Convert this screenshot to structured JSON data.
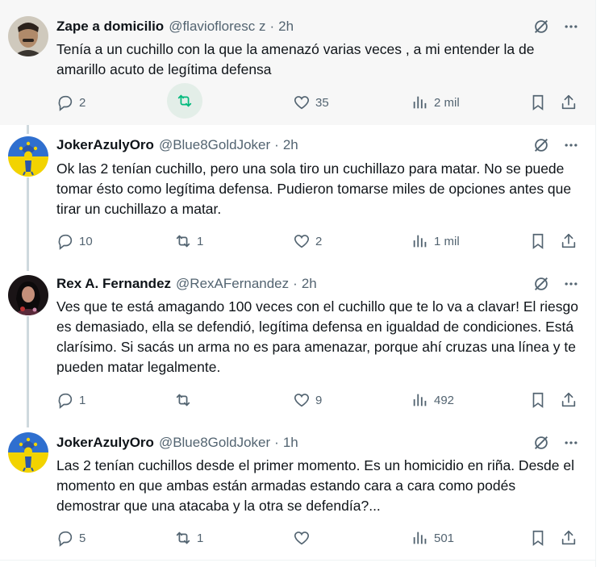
{
  "replies": [
    {
      "name": "Zape a domicilio",
      "handle": "@flaviofloresc z",
      "time": "2h",
      "text": "Tenía a un cuchillo  con la que la amenazó varias veces , a mi entender la de amarillo acuto de legítima defensa",
      "replies": "2",
      "retweets": "",
      "likes": "35",
      "views": "2 mil",
      "retweeted": true,
      "avatar": "portrait-man-mustache"
    },
    {
      "name": "JokerAzulyOro",
      "handle": "@Blue8GoldJoker",
      "time": "2h",
      "text": "Ok las 2 tenían cuchillo, pero una sola tiro un cuchillazo para matar. No se puede tomar ésto como legítima defensa. Pudieron tomarse miles de opciones antes que tirar un cuchillazo a matar.",
      "replies": "10",
      "retweets": "1",
      "likes": "2",
      "views": "1 mil",
      "retweeted": false,
      "avatar": "blue-yellow-jester"
    },
    {
      "name": "Rex A. Fernandez",
      "handle": "@RexAFernandez",
      "time": "2h",
      "text": "Ves que te está amagando 100 veces con el cuchillo que te lo va a clavar! El riesgo es demasiado, ella se defendió, legítima defensa en igualdad de condiciones. Está clarísimo. Si sacás un arma no es para amenazar, porque ahí cruzas una línea y te pueden matar legalmente.",
      "replies": "1",
      "retweets": "",
      "likes": "9",
      "views": "492",
      "retweeted": false,
      "avatar": "rock-musician"
    },
    {
      "name": "JokerAzulyOro",
      "handle": "@Blue8GoldJoker",
      "time": "1h",
      "text": "Las 2 tenían cuchillos desde el primer momento. Es un homicidio en riña. Desde el momento en que ambas están armadas estando cara a cara como podés demostrar que una atacaba y la otra se defendía?...",
      "replies": "5",
      "retweets": "1",
      "likes": "",
      "views": "501",
      "retweeted": false,
      "avatar": "blue-yellow-jester"
    }
  ],
  "colors": {
    "text": "#0f1419",
    "secondary": "#536471",
    "retweet_green": "#00ba7c",
    "highlight_bg": "#f7f7f7",
    "thread_line": "#cfd9de"
  },
  "icons": {
    "reply": "reply-icon",
    "retweet": "retweet-icon",
    "like": "like-icon",
    "views": "views-icon",
    "bookmark": "bookmark-icon",
    "share": "share-icon",
    "grok": "grok-icon",
    "more": "more-icon"
  }
}
